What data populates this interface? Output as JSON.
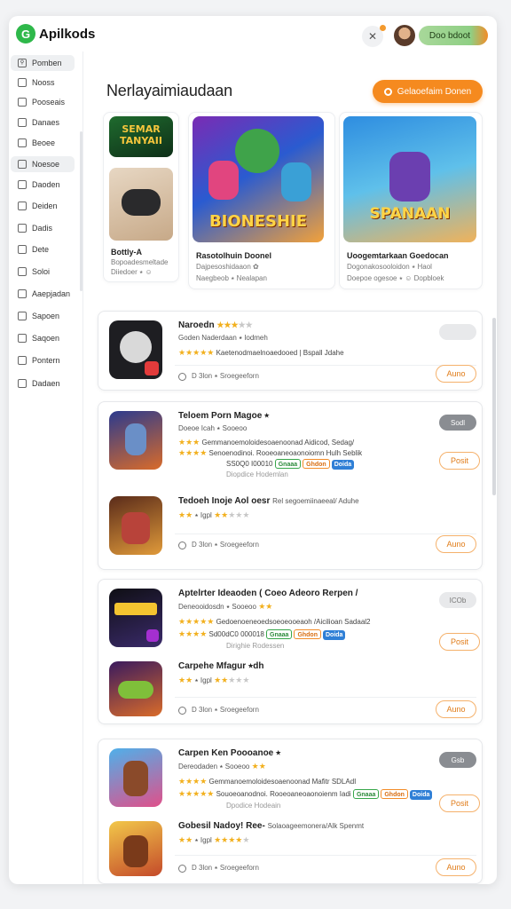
{
  "app": {
    "logo_letter": "G",
    "name": "Apilkods"
  },
  "header": {
    "icon_glyph": "✕",
    "pill_label": "Doo bdoot"
  },
  "sidebar": {
    "items": [
      {
        "label": "Pomben",
        "icon": "search-icon"
      },
      {
        "label": "Nooss",
        "icon": "home-icon"
      },
      {
        "label": "Pooseais",
        "icon": "grid-icon"
      },
      {
        "label": "Danaes",
        "icon": "folder-icon"
      },
      {
        "label": "Beoee",
        "icon": "chat-icon"
      },
      {
        "label": "Noesoe",
        "icon": "list-icon"
      },
      {
        "label": "Daoden",
        "icon": "box-icon"
      },
      {
        "label": "Deiden",
        "icon": "globe-icon"
      },
      {
        "label": "Dadis",
        "icon": "cart-icon"
      },
      {
        "label": "Dete",
        "icon": "tag-icon"
      },
      {
        "label": "Soloi",
        "icon": "book-icon"
      },
      {
        "label": "Aaepjadan",
        "icon": "star-icon"
      },
      {
        "label": "Sapoen",
        "icon": "chart-icon"
      },
      {
        "label": "Saqoen",
        "icon": "user-icon"
      },
      {
        "label": "Pontern",
        "icon": "calendar-icon"
      },
      {
        "label": "Dadaen",
        "icon": "settings-icon"
      }
    ]
  },
  "page": {
    "title": "Nerlayaimiaudaan",
    "cta": "Gelaoefaim Donen"
  },
  "featured": [
    {
      "art": "SEMAR\nTANYAII",
      "title": "Bottly-A",
      "sub1": "Bopoadesmeltade",
      "sub2": "Diiedoer ⭑ ☺"
    },
    {
      "art": "BIONESHIE",
      "title": "Rasotolhuin Doonel",
      "sub1": "Dajpesoshidaaon ✿",
      "sub2": "Naegbeob ⭑ Nealapan"
    },
    {
      "art": "SPANAAN",
      "title": "Uoogemtarkaan Goedocan",
      "sub1": "Dogonakosooloidon ⭑ Haol",
      "sub2": "Doepoe ogesoe ⭑ ☺ Dopbloek"
    }
  ],
  "list": [
    {
      "rows": [
        {
          "title": "Naroedn",
          "line1": "Goden Naderdaan ⭑ lodmeh",
          "desc": "Kaetenodmaelnoaedooed | Bspall Jdahe"
        }
      ],
      "footer": "D 3lon ⭑ Sroegeeforn",
      "button": "Auno",
      "badge": ""
    },
    {
      "rows": [
        {
          "title": "Teloem Porn Magoe ⭑",
          "line1": "Doeoe Icah ⭑ Sooeoo",
          "desc": "Gemmanoemoloidesoaenoonad Aidicod, Sedag/",
          "desc2": "Senoenodinoi. Rooeoaneoaonoiomn Hulh Seblik",
          "desc3": "SS0Q0 I00010",
          "desc4": "Diopdice Hodemlan",
          "tags": [
            "Gnaaa",
            "Ghdon",
            "Doida"
          ]
        },
        {
          "title": "Tedoeh Inoje Aol oesr",
          "line1": "⭑ Igpl",
          "desc": "Rel segoemiinaeeal/ Aduhe"
        }
      ],
      "footer": "D 3lon ⭑ Sroegeeforn",
      "button": "Auno",
      "side_button": "Posit",
      "badge": "Sodl"
    },
    {
      "rows": [
        {
          "title": "Aptelrter Ideaoden ( Coeo Adeoro Rerpen /",
          "line1": "Deneooidosdn ⭑ Sooeoo",
          "desc": "Gedoenoeneoedsoeoeooeaoh /Aicilioan Sadaal2",
          "desc2": "Sd00dC0 000018",
          "desc3": "Dirighie Rodessen",
          "tags": [
            "Gnaaa",
            "Ghdon",
            "Doida"
          ]
        },
        {
          "title": "Carpehe Mfagur ⭑dh",
          "line1": "⭑ Igpl",
          "desc": ""
        }
      ],
      "footer": "D 3lon ⭑ Sroegeeforn",
      "button": "Auno",
      "side_button": "Posit",
      "badge": "ICOb"
    },
    {
      "rows": [
        {
          "title": "Carpen Ken Poooanoe ⭑",
          "line1": "Dereodaden ⭑ Sooeoo",
          "desc": "Gemmanoemoloidesoaenoonad Mafitr SDLAdI",
          "desc2": "Souoeoanodnoi. Rooeoaneoaonoienm Iadi",
          "desc3": "Dpodice Hodeain",
          "tags": [
            "Gnaaa",
            "Ghdon",
            "Doida"
          ]
        },
        {
          "title": "Gobesil Nadoy! Ree-",
          "line1": "⭑ Igpl",
          "desc": "Solaoageemonera/Alk Spenmt"
        }
      ],
      "footer": "D 3lon ⭑ Sroegeeforn",
      "button": "Auno",
      "side_button": "Posit",
      "badge": "Gsb"
    }
  ],
  "colors": {
    "accent": "#f58a1f",
    "brand": "#2eb84a",
    "star": "#f2b01e"
  }
}
